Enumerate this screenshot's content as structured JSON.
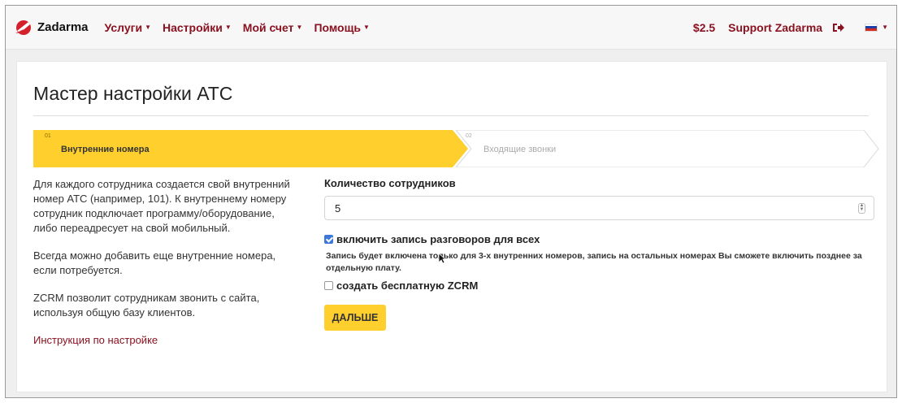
{
  "navbar": {
    "brand": "Zadarma",
    "menu": [
      {
        "label": "Услуги"
      },
      {
        "label": "Настройки"
      },
      {
        "label": "Мой счет"
      },
      {
        "label": "Помощь"
      }
    ],
    "balance": "$2.5",
    "account": "Support Zadarma",
    "icons": {
      "logout": "logout-icon",
      "language": "russian-flag-icon"
    }
  },
  "page": {
    "title": "Мастер настройки АТС",
    "steps": [
      {
        "num": "01",
        "label": "Внутренние номера",
        "active": true
      },
      {
        "num": "02",
        "label": "Входящие звонки",
        "active": false
      }
    ],
    "info": [
      "Для каждого сотрудника создается свой внутренний номер АТС (например, 101). К внутреннему номеру сотрудник подключает программу/оборудование, либо переадресует на свой мобильный.",
      "Всегда можно добавить еще внутренние номера, если потребуется.",
      "ZCRM позволит сотрудникам звонить с сайта, используя общую базу клиентов."
    ],
    "guide_link": "Инструкция по настройке"
  },
  "form": {
    "employees_label": "Количество сотрудников",
    "employees_value": "5",
    "record_label": "включить запись разговоров для всех",
    "record_checked": true,
    "record_note": "Запись будет включена только для 3-х внутренних номеров, запись на остальных номерах Вы сможете включить позднее за отдельную плату.",
    "zcrm_label": "создать бесплатную ZCRM",
    "zcrm_checked": false,
    "next_button": "ДАЛЬШЕ"
  },
  "colors": {
    "brand": "#8a1220",
    "accent": "#ffcf2e",
    "checkbox": "#3b78d8"
  }
}
